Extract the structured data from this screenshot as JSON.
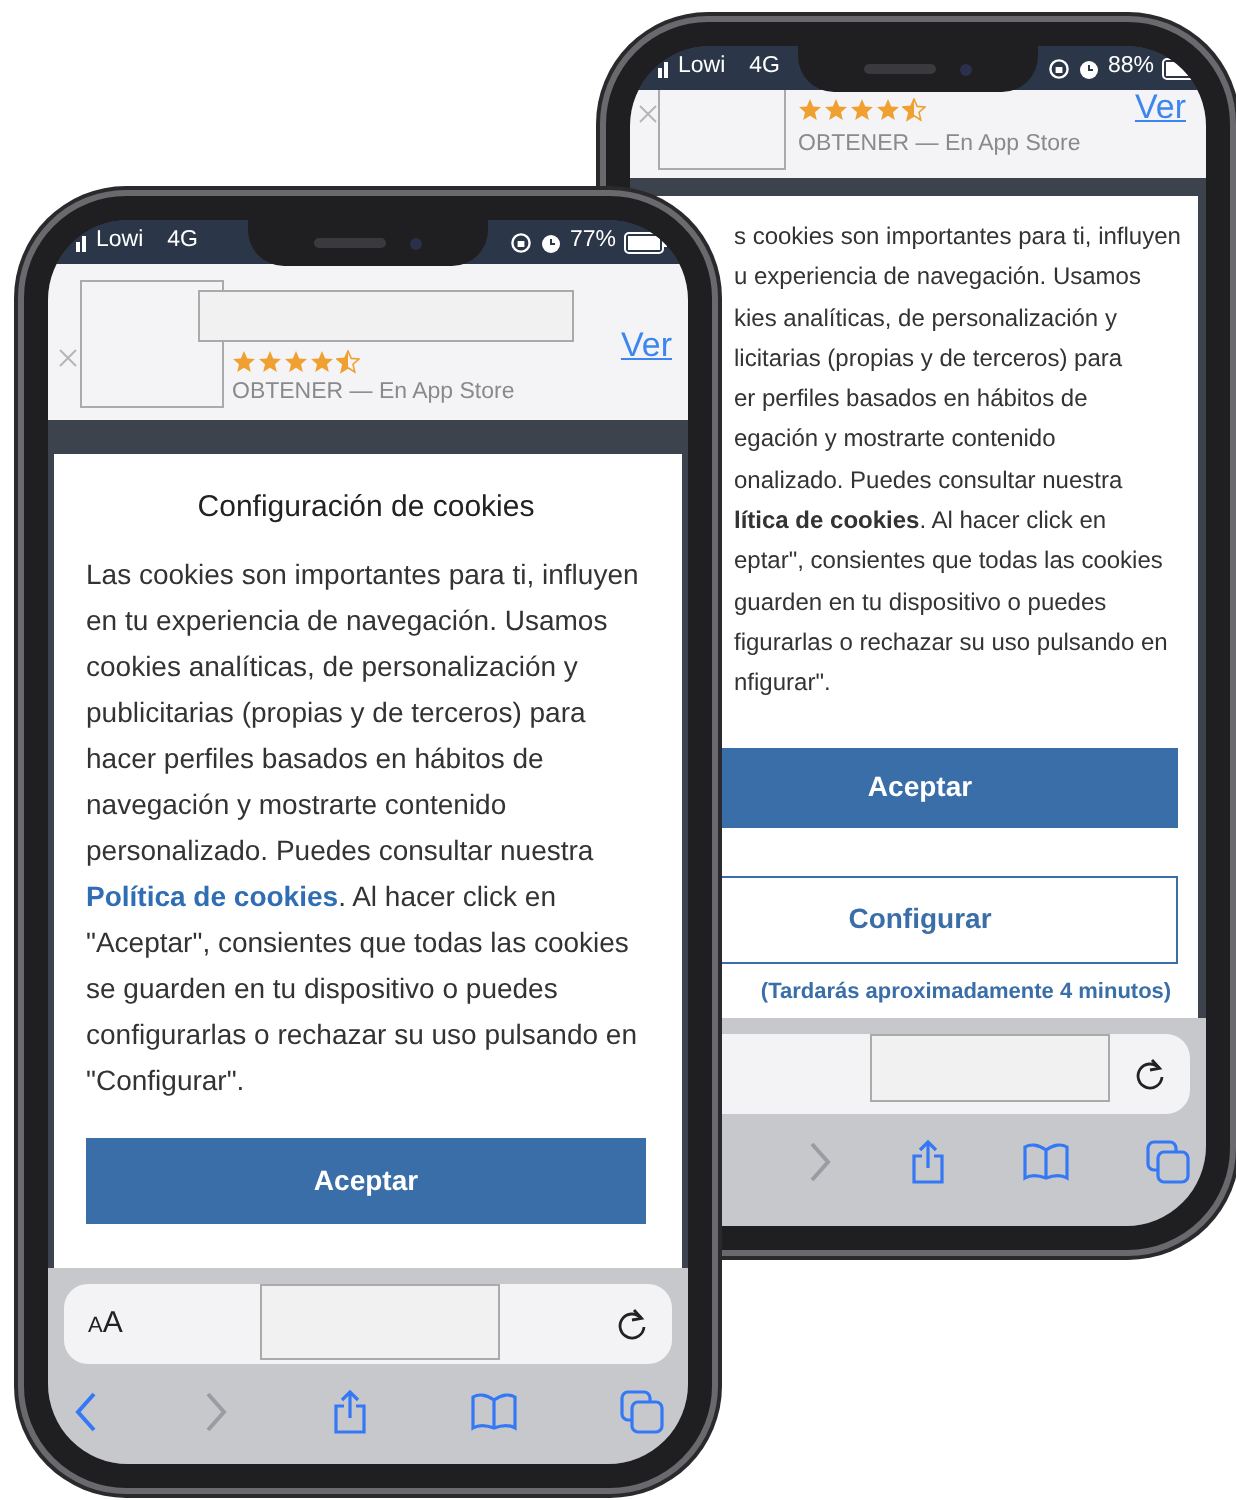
{
  "phones": [
    {
      "kind": "back",
      "status_bar": {
        "carrier": "Lowi",
        "network": "4G",
        "battery": "88%"
      },
      "app_banner": {
        "stars": 4.5,
        "subtitle": "OBTENER — En App Store",
        "action": "Ver"
      },
      "cookie_dialog": {
        "lines": [
          "s cookies son importantes para ti, influyen",
          "u experiencia de navegación. Usamos",
          "kies analíticas, de personalización y",
          "licitarias (propias y de terceros) para",
          "er perfiles basados en hábitos de",
          "egación y mostrarte contenido",
          "onalizado. Puedes consultar nuestra",
          "**lítica de cookies**. Al hacer click en",
          "eptar\", consientes que todas las cookies",
          "guarden en tu dispositivo o puedes",
          "figurarlas o rechazar su uso pulsando en",
          "nfigurar\"."
        ],
        "buttons": [
          {
            "label": "Aceptar",
            "kind": "primary"
          },
          {
            "label": "Configurar",
            "kind": "outline"
          }
        ],
        "note": "(Tardarás aproximadamente 4 minutos)"
      },
      "browser": {
        "toolbar": [
          {
            "kind": "forward",
            "disabled": true
          },
          {
            "kind": "share",
            "disabled": false
          },
          {
            "kind": "bookmarks",
            "disabled": false
          },
          {
            "kind": "tabs",
            "disabled": false
          }
        ]
      }
    },
    {
      "kind": "front",
      "status_bar": {
        "carrier": "Lowi",
        "network": "4G",
        "battery": "77%"
      },
      "app_banner": {
        "stars": 4.5,
        "subtitle": "OBTENER — En App Store",
        "action": "Ver"
      },
      "cookie_dialog": {
        "title": "Configuración de cookies",
        "text_before": "Las cookies son importantes para ti, influyen en tu experiencia de navegación. Usamos cookies analíticas, de personalización y publicitarias (propias y de terceros) para hacer perfiles basados en hábitos de navegación y mostrarte contenido personalizado. Puedes consultar nuestra ",
        "link": "Política de cookies",
        "text_after": ". Al hacer click en \"Aceptar\", consientes que todas las cookies se guarden en tu dispositivo o puedes configurarlas o rechazar su uso pulsando en \"Configurar\".",
        "buttons": [
          {
            "label": "Aceptar",
            "kind": "primary"
          }
        ]
      },
      "browser": {
        "text_size": "AA",
        "toolbar": [
          {
            "kind": "back",
            "disabled": false
          },
          {
            "kind": "forward",
            "disabled": true
          },
          {
            "kind": "share",
            "disabled": false
          },
          {
            "kind": "bookmarks",
            "disabled": false
          },
          {
            "kind": "tabs",
            "disabled": false
          }
        ]
      }
    }
  ]
}
